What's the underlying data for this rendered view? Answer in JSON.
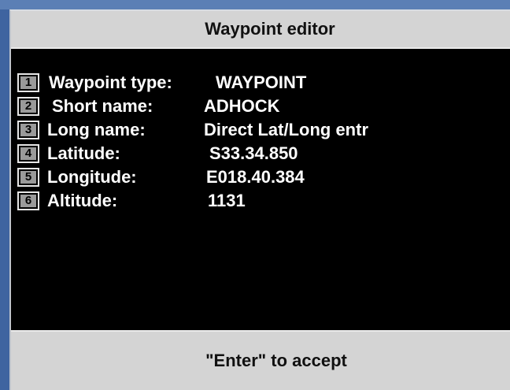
{
  "window": {
    "title": "Waypoint editor"
  },
  "fields": [
    {
      "number": "1",
      "label": "Waypoint type:",
      "value": "WAYPOINT"
    },
    {
      "number": "2",
      "label": "Short name:",
      "value": "ADHOCK"
    },
    {
      "number": "3",
      "label": "Long name:",
      "value": "Direct Lat/Long entr"
    },
    {
      "number": "4",
      "label": "Latitude:",
      "value": "S33.34.850"
    },
    {
      "number": "5",
      "label": "Longitude:",
      "value": "E018.40.384"
    },
    {
      "number": "6",
      "label": "Altitude:",
      "value": "1131"
    }
  ],
  "footer": {
    "hint": "\"Enter\" to accept"
  },
  "colors": {
    "background": "#000000",
    "bar": "#d4d4d4",
    "text": "#ffffff",
    "desktop": "#4a6fa8"
  }
}
